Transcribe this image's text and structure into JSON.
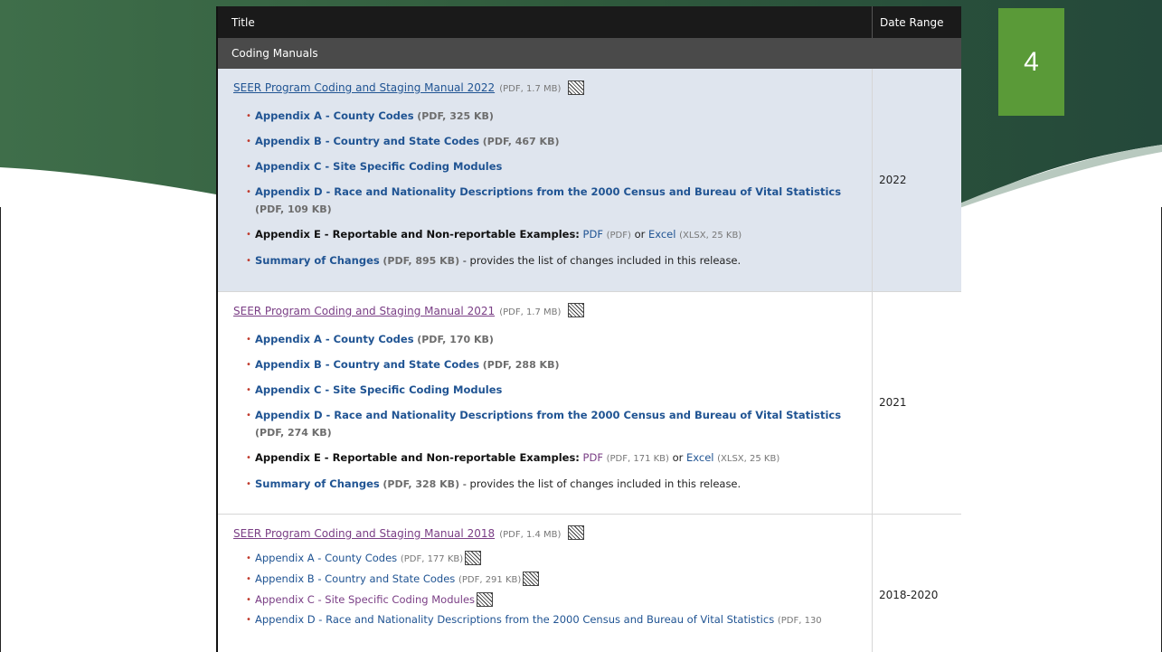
{
  "slide": {
    "number": "4"
  },
  "table": {
    "header": {
      "title": "Title",
      "date_range": "Date Range"
    },
    "group_label": "Coding Manuals",
    "manuals": [
      {
        "link": "SEER Program Coding and Staging Manual 2022",
        "meta": "(PDF, 1.7 MB)",
        "date": "2022",
        "items": {
          "a_link": "Appendix A - County Codes",
          "a_meta": "(PDF, 325 KB)",
          "b_link": "Appendix B - Country and State Codes",
          "b_meta": "(PDF, 467 KB)",
          "c_link": "Appendix C - Site Specific Coding Modules",
          "d_link": "Appendix D - Race and Nationality Descriptions from the 2000 Census and Bureau of Vital Statistics",
          "d_meta": "(PDF, 109 KB)",
          "e_label": "Appendix E - Reportable and Non-reportable Examples:",
          "e_pdf": "PDF",
          "e_pdf_meta": "(PDF)",
          "e_or": "or",
          "e_excel": "Excel",
          "e_excel_meta": "(XLSX, 25 KB)",
          "s_link": "Summary of Changes",
          "s_meta": "(PDF, 895 KB)",
          "s_text": "- provides the list of changes included in this release."
        }
      },
      {
        "link": "SEER Program Coding and Staging Manual 2021",
        "meta": "(PDF, 1.7 MB)",
        "date": "2021",
        "items": {
          "a_link": "Appendix A - County Codes",
          "a_meta": "(PDF, 170 KB)",
          "b_link": "Appendix B - Country and State Codes",
          "b_meta": "(PDF, 288 KB)",
          "c_link": "Appendix C - Site Specific Coding Modules",
          "d_link": "Appendix D - Race and Nationality Descriptions from the 2000 Census and Bureau of Vital Statistics",
          "d_meta": "(PDF, 274 KB)",
          "e_label": "Appendix E - Reportable and Non-reportable Examples:",
          "e_pdf": "PDF",
          "e_pdf_meta": "(PDF, 171 KB)",
          "e_or": "or",
          "e_excel": "Excel",
          "e_excel_meta": "(XLSX, 25 KB)",
          "s_link": "Summary of Changes",
          "s_meta": "(PDF, 328 KB)",
          "s_text": "- provides the list of changes included in this release."
        }
      },
      {
        "link": "SEER Program Coding and Staging Manual 2018",
        "meta": "(PDF, 1.4 MB)",
        "date": "2018-2020",
        "items": {
          "a_link": "Appendix A - County Codes",
          "a_meta": "(PDF, 177 KB)",
          "b_link": "Appendix B - Country and State Codes",
          "b_meta": "(PDF, 291 KB)",
          "c_link": "Appendix C - Site Specific Coding Modules",
          "d_link": "Appendix D - Race and Nationality Descriptions from the 2000 Census and Bureau of Vital Statistics",
          "d_meta": "(PDF, 130"
        }
      }
    ]
  },
  "colors": {
    "slide_green": "#5a9a38",
    "band_dark": "#2f5a3c",
    "link_blue": "#205493",
    "visited": "#7a3e85",
    "highlight_row": "#dfe5ee"
  }
}
